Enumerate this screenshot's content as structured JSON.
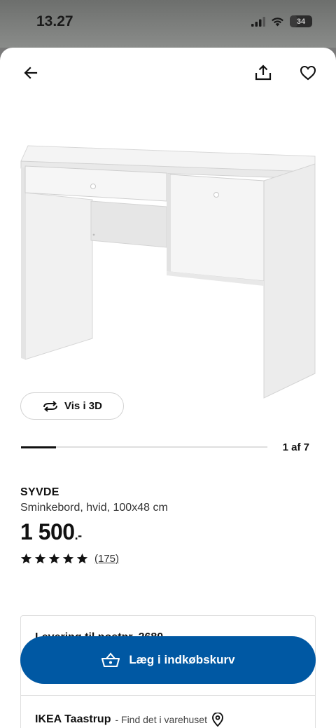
{
  "status_bar": {
    "time": "13.27",
    "battery": "34"
  },
  "product": {
    "name": "SYVDE",
    "description": "Sminkebord, hvid, 100x48 cm",
    "price_main": "1 500",
    "price_suffix": ".-",
    "rating_stars": 5,
    "review_count": "(175)"
  },
  "gallery": {
    "view_3d_label": "Vis i 3D",
    "counter": "1 af 7",
    "progress": 0.143
  },
  "delivery": {
    "title": "Levering til postnr. 2680"
  },
  "store": {
    "name": "IKEA Taastrup",
    "subtitle": "- Find det i varehuset"
  },
  "actions": {
    "add_to_cart_label": "Læg i indkøbskurv"
  },
  "icons": {
    "back": "arrow-left-icon",
    "share": "share-icon",
    "favorite": "heart-icon",
    "rotate": "rotate-3d-icon",
    "cart": "basket-icon",
    "location": "location-pin-icon"
  },
  "colors": {
    "primary": "#0058a3",
    "text": "#111111"
  }
}
